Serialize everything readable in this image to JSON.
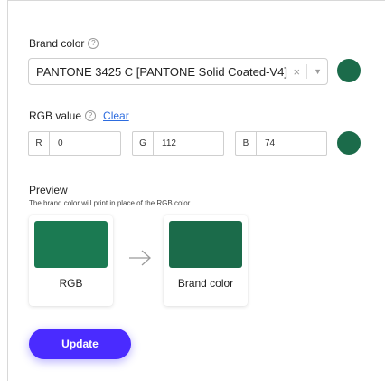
{
  "brand_color": {
    "label": "Brand color",
    "help_icon": "help-circle-icon",
    "selected_value": "PANTONE 3425 C [PANTONE Solid Coated-V4]",
    "clear_glyph": "×",
    "dropdown_glyph": "▼",
    "swatch_color": "#1b6b4a"
  },
  "rgb": {
    "label": "RGB value",
    "help_icon": "help-circle-icon",
    "clear_label": "Clear",
    "channels": [
      {
        "label": "R",
        "value": "0"
      },
      {
        "label": "G",
        "value": "112"
      },
      {
        "label": "B",
        "value": "74"
      }
    ],
    "swatch_color": "#1b6b4a"
  },
  "preview": {
    "title": "Preview",
    "subtitle": "The brand color will print in place of the RGB color",
    "rgb_card": {
      "caption": "RGB",
      "color": "#1b7a52"
    },
    "brand_card": {
      "caption": "Brand color",
      "color": "#1b6b4a"
    },
    "arrow_icon": "arrow-right-icon"
  },
  "update_button": {
    "label": "Update",
    "color": "#4a2bff"
  }
}
